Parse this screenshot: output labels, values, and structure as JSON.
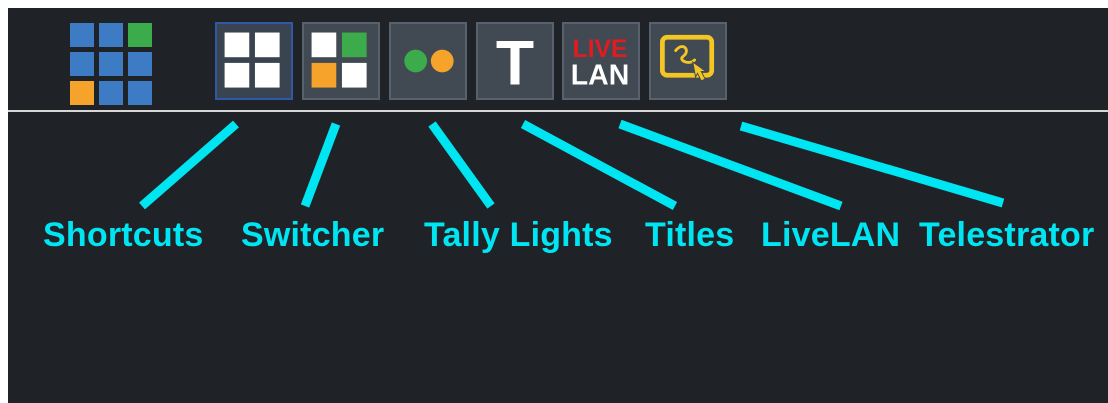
{
  "toolbar": {
    "buttons": [
      {
        "name": "Shortcuts",
        "icon": "shortcuts-grid-icon",
        "active": true
      },
      {
        "name": "Switcher",
        "icon": "switcher-icon",
        "active": false
      },
      {
        "name": "Tally Lights",
        "icon": "tally-lights-icon",
        "active": false
      },
      {
        "name": "Titles",
        "icon": "titles-icon",
        "active": false
      },
      {
        "name": "LiveLAN",
        "icon": "livelan-icon",
        "active": false
      },
      {
        "name": "Telestrator",
        "icon": "telestrator-icon",
        "active": false
      }
    ],
    "livelan_icon_text_top": "LIVE",
    "livelan_icon_text_bottom": "LAN",
    "titles_icon_text": "T"
  },
  "labels": {
    "shortcuts": "Shortcuts",
    "switcher": "Switcher",
    "tally_lights": "Tally Lights",
    "titles": "Titles",
    "livelan": "LiveLAN",
    "telestrator": "Telestrator"
  },
  "colors": {
    "background": "#1f2226",
    "button_fill": "#414952",
    "button_border": "#59626c",
    "active_border": "#3157a8",
    "label_cyan": "#00e5f2",
    "divider": "#d7d7d7",
    "tile_blue": "#3d7bc4",
    "tile_green": "#3bab4b",
    "tile_orange": "#f5a32a",
    "tile_white": "#ffffff",
    "livelan_red": "#e11b22",
    "telestrator_yellow": "#f3c623"
  }
}
